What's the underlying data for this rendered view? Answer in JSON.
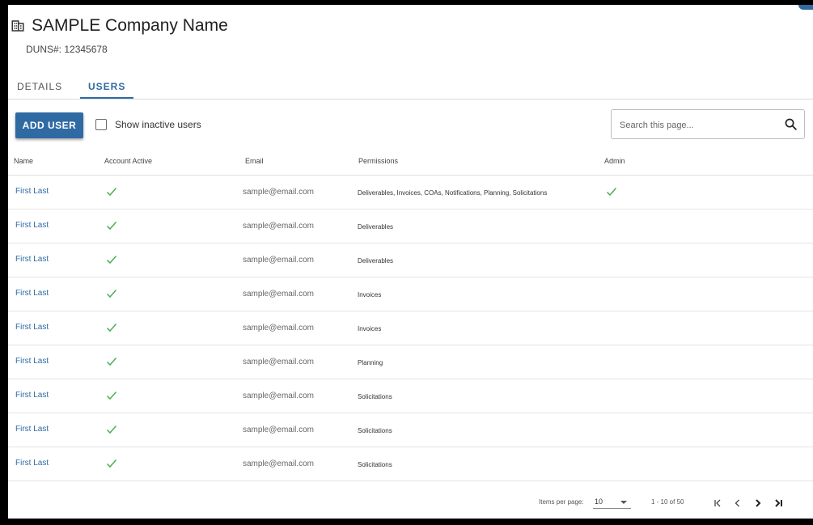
{
  "company": {
    "name": "SAMPLE Company Name",
    "duns": "DUNS#: 12345678"
  },
  "tabs": [
    {
      "label": "DETAILS"
    },
    {
      "label": "USERS"
    }
  ],
  "toolbar": {
    "add_user_label": "ADD USER",
    "show_inactive_label": "Show inactive users",
    "search_placeholder": "Search this page..."
  },
  "table": {
    "columns": [
      "Name",
      "Account Active",
      "Email",
      "Permissions",
      "Admin"
    ],
    "rows": [
      {
        "name": "First Last",
        "email": "sample@email.com",
        "permissions": "Deliverables, Invoices, COAs, Notifications, Planning, Solicitations",
        "active": true,
        "admin": true
      },
      {
        "name": "First Last",
        "email": "sample@email.com",
        "permissions": "Deliverables",
        "active": true,
        "admin": false
      },
      {
        "name": "First Last",
        "email": "sample@email.com",
        "permissions": "Deliverables",
        "active": true,
        "admin": false
      },
      {
        "name": "First Last",
        "email": "sample@email.com",
        "permissions": "Invoices",
        "active": true,
        "admin": false
      },
      {
        "name": "First Last",
        "email": "sample@email.com",
        "permissions": "Invoices",
        "active": true,
        "admin": false
      },
      {
        "name": "First Last",
        "email": "sample@email.com",
        "permissions": "Planning",
        "active": true,
        "admin": false
      },
      {
        "name": "First Last",
        "email": "sample@email.com",
        "permissions": "Solicitations",
        "active": true,
        "admin": false
      },
      {
        "name": "First Last",
        "email": "sample@email.com",
        "permissions": "Solicitations",
        "active": true,
        "admin": false
      },
      {
        "name": "First Last",
        "email": "sample@email.com",
        "permissions": "Solicitations",
        "active": true,
        "admin": false
      }
    ]
  },
  "pagination": {
    "items_per_page_label": "Items per page:",
    "items_per_page_value": "10",
    "range_label": "1 - 10 of 50"
  },
  "icons": {
    "title": "building-icon",
    "search": "search-icon",
    "check": "check-icon",
    "first": "first-page-icon",
    "prev": "chevron-left-icon",
    "next": "chevron-right-icon",
    "last": "last-page-icon"
  },
  "colors": {
    "accent": "#2f6aa3",
    "check": "#4caf50"
  }
}
